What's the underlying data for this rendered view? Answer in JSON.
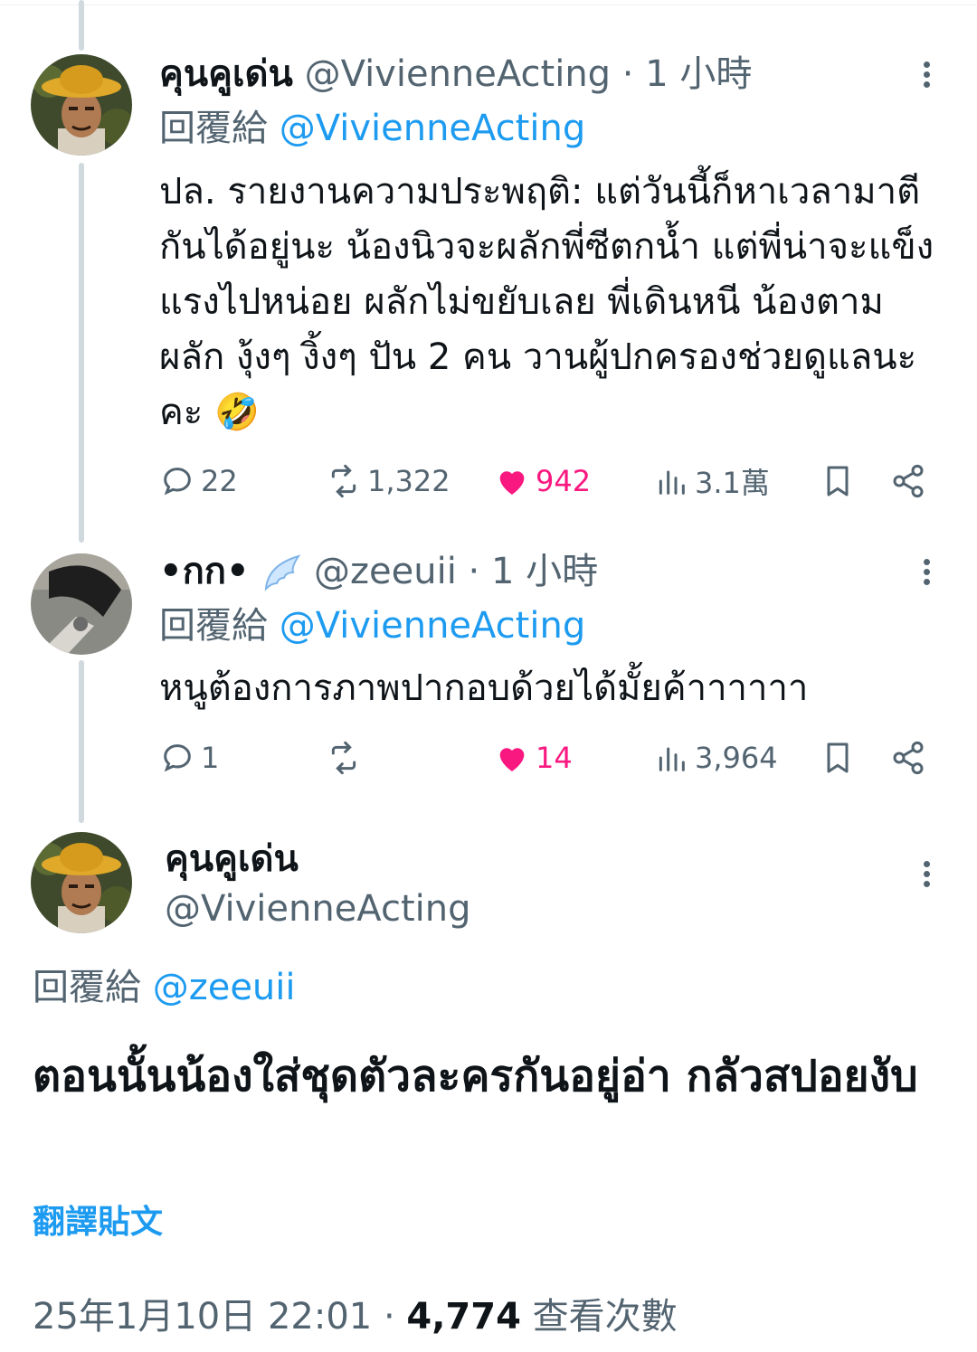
{
  "colors": {
    "accent": "#1d9bf0",
    "like": "#f91880",
    "muted": "#536471",
    "text": "#0f1419"
  },
  "replies": [
    {
      "display_name": "คุนคูเด่น",
      "handle": "@VivienneActing",
      "separator": "·",
      "time": "1 小時",
      "reply_label": "回覆給",
      "reply_to": "@VivienneActing",
      "text": "ปล. รายงานความประพฤติ: แต่วันนี้ก็หาเวลามาตีกันได้อยู่นะ น้องนิวจะผลักพี่ซีตกน้ำ แต่พี่น่าจะแข็งแรงไปหน่อย ผลักไม่ขยับเลย พี่เดินหนี น้องตามผลัก งุ้งๆ งิ้งๆ ปัน 2 คน วานผู้ปกครองช่วยดูแลนะคะ",
      "emoji": "🤣",
      "stats": {
        "replies": "22",
        "reposts": "1,322",
        "likes": "942",
        "views": "3.1萬"
      }
    },
    {
      "display_name": "•กก•",
      "name_emoji": "wing-icon",
      "handle": "@zeeuii",
      "separator": "·",
      "time": "1 小時",
      "reply_label": "回覆給",
      "reply_to": "@VivienneActing",
      "text": "หนูต้องการภาพปากอบด้วยได้มั้ยค้าาาาาา",
      "stats": {
        "replies": "1",
        "reposts": "",
        "likes": "14",
        "views": "3,964"
      }
    }
  ],
  "main": {
    "display_name": "คุนคูเด่น",
    "handle": "@VivienneActing",
    "reply_label": "回覆給",
    "reply_to": "@zeeuii",
    "text": "ตอนนั้นน้องใส่ชุดตัวละครกันอยู่อ่า กลัวสปอยงับ",
    "translate": "翻譯貼文",
    "date": "25年1月10日 22:01",
    "separator": "·",
    "views": "4,774",
    "views_label": "查看次數"
  }
}
